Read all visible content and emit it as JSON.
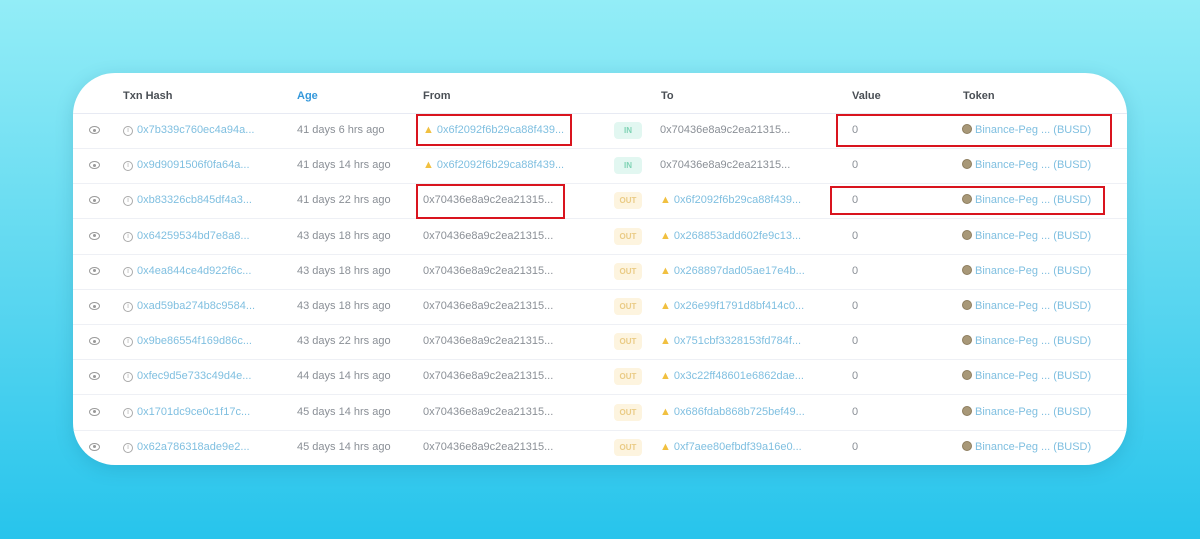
{
  "columns": {
    "txn_hash": "Txn Hash",
    "age": "Age",
    "from": "From",
    "to": "To",
    "value": "Value",
    "token": "Token"
  },
  "colors": {
    "accent": "#3498db",
    "highlight": "#d9141e",
    "in": "#7fd3b5",
    "out": "#eacb85"
  },
  "rows": [
    {
      "hash": "0x7b339c760ec4a94a...",
      "age": "41 days 6 hrs ago",
      "from": "0x6f2092f6b29ca88f439...",
      "from_warn": true,
      "dir": "IN",
      "to": "0x70436e8a9c2ea21315...",
      "to_warn": false,
      "value": "0",
      "token_name": "Binance-Peg ...",
      "token_symbol": "(BUSD)"
    },
    {
      "hash": "0x9d9091506f0fa64a...",
      "age": "41 days 14 hrs ago",
      "from": "0x6f2092f6b29ca88f439...",
      "from_warn": true,
      "dir": "IN",
      "to": "0x70436e8a9c2ea21315...",
      "to_warn": false,
      "value": "0",
      "token_name": "Binance-Peg ...",
      "token_symbol": "(BUSD)"
    },
    {
      "hash": "0xb83326cb845df4a3...",
      "age": "41 days 22 hrs ago",
      "from": "0x70436e8a9c2ea21315...",
      "from_warn": false,
      "dir": "OUT",
      "to": "0x6f2092f6b29ca88f439...",
      "to_warn": true,
      "value": "0",
      "token_name": "Binance-Peg ...",
      "token_symbol": "(BUSD)"
    },
    {
      "hash": "0x64259534bd7e8a8...",
      "age": "43 days 18 hrs ago",
      "from": "0x70436e8a9c2ea21315...",
      "from_warn": false,
      "dir": "OUT",
      "to": "0x268853add602fe9c13...",
      "to_warn": true,
      "value": "0",
      "token_name": "Binance-Peg ...",
      "token_symbol": "(BUSD)"
    },
    {
      "hash": "0x4ea844ce4d922f6c...",
      "age": "43 days 18 hrs ago",
      "from": "0x70436e8a9c2ea21315...",
      "from_warn": false,
      "dir": "OUT",
      "to": "0x268897dad05ae17e4b...",
      "to_warn": true,
      "value": "0",
      "token_name": "Binance-Peg ...",
      "token_symbol": "(BUSD)"
    },
    {
      "hash": "0xad59ba274b8c9584...",
      "age": "43 days 18 hrs ago",
      "from": "0x70436e8a9c2ea21315...",
      "from_warn": false,
      "dir": "OUT",
      "to": "0x26e99f1791d8bf414c0...",
      "to_warn": true,
      "value": "0",
      "token_name": "Binance-Peg ...",
      "token_symbol": "(BUSD)"
    },
    {
      "hash": "0x9be86554f169d86c...",
      "age": "43 days 22 hrs ago",
      "from": "0x70436e8a9c2ea21315...",
      "from_warn": false,
      "dir": "OUT",
      "to": "0x751cbf3328153fd784f...",
      "to_warn": true,
      "value": "0",
      "token_name": "Binance-Peg ...",
      "token_symbol": "(BUSD)"
    },
    {
      "hash": "0xfec9d5e733c49d4e...",
      "age": "44 days 14 hrs ago",
      "from": "0x70436e8a9c2ea21315...",
      "from_warn": false,
      "dir": "OUT",
      "to": "0x3c22ff48601e6862dae...",
      "to_warn": true,
      "value": "0",
      "token_name": "Binance-Peg ...",
      "token_symbol": "(BUSD)"
    },
    {
      "hash": "0x1701dc9ce0c1f17c...",
      "age": "45 days 14 hrs ago",
      "from": "0x70436e8a9c2ea21315...",
      "from_warn": false,
      "dir": "OUT",
      "to": "0x686fdab868b725bef49...",
      "to_warn": true,
      "value": "0",
      "token_name": "Binance-Peg ...",
      "token_symbol": "(BUSD)"
    },
    {
      "hash": "0x62a786318ade9e2...",
      "age": "45 days 14 hrs ago",
      "from": "0x70436e8a9c2ea21315...",
      "from_warn": false,
      "dir": "OUT",
      "to": "0xf7aee80efbdf39a16e0...",
      "to_warn": true,
      "value": "0",
      "token_name": "Binance-Peg ...",
      "token_symbol": "(BUSD)"
    }
  ]
}
